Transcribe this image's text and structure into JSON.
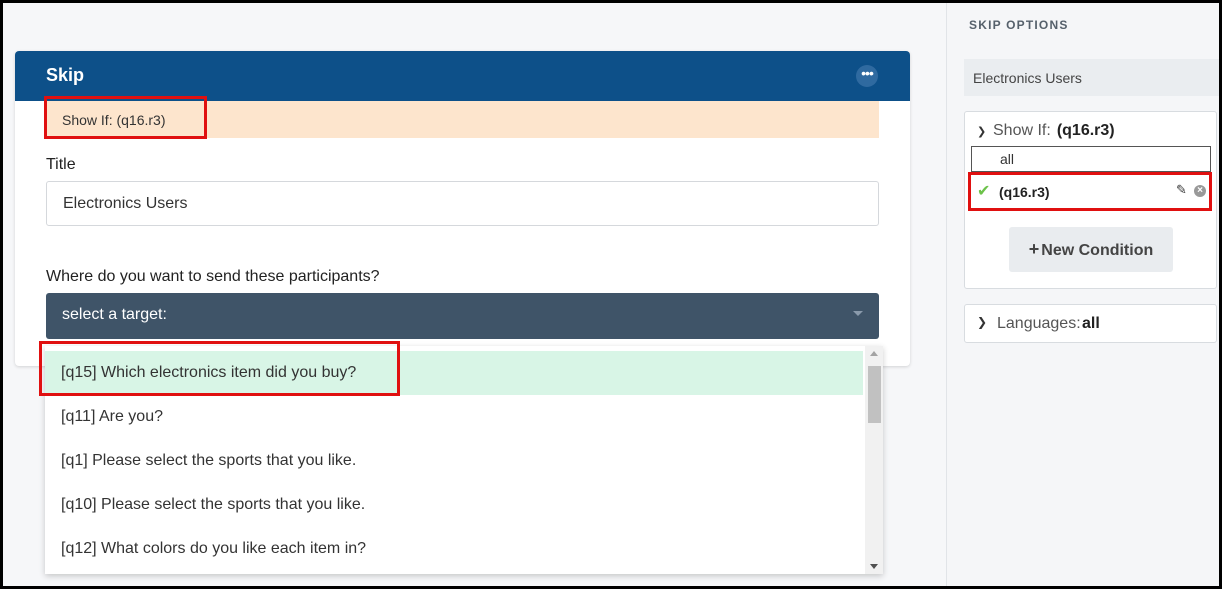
{
  "card": {
    "title": "Skip",
    "more_label": "•••",
    "show_if_text": "Show If: (q16.r3)",
    "title_label": "Title",
    "title_value": "Electronics Users",
    "target_question": "Where do you want to send these participants?",
    "select_placeholder": "select a target:"
  },
  "dropdown": {
    "items": [
      {
        "label": "[q15] Which electronics item did you buy?",
        "active": true
      },
      {
        "label": "[q11] Are you?"
      },
      {
        "label": "[q1] Please select the sports that you like."
      },
      {
        "label": "[q10] Please select the sports that you like."
      },
      {
        "label": "[q12] What colors do you like each item in?"
      }
    ]
  },
  "sidebar": {
    "heading": "SKIP OPTIONS",
    "crumb": "Electronics Users",
    "show_if_label": "Show If:",
    "show_if_value": "(q16.r3)",
    "all_label": "all",
    "condition": "(q16.r3)",
    "new_condition": "New Condition",
    "new_condition_icon": "+",
    "languages_label": "Languages:",
    "languages_value": "all"
  },
  "colors": {
    "header": "#0d5089",
    "select_bg": "#3f5468",
    "show_if_bg": "#fde5cd",
    "active_item": "#d8f5e6",
    "highlight": "#e01010"
  }
}
